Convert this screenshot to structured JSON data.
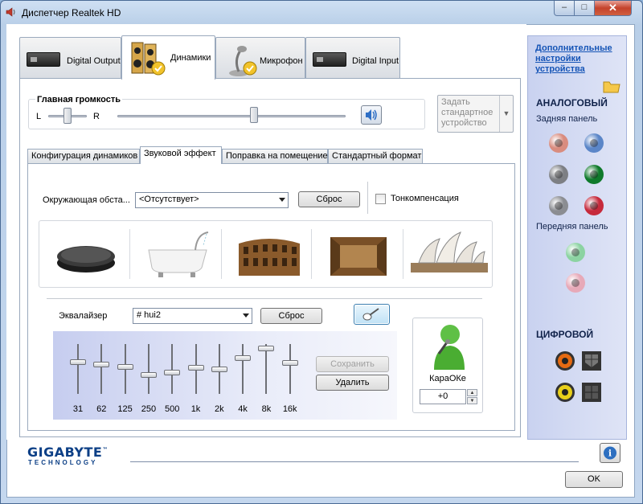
{
  "window": {
    "title": "Диспетчер Realtek HD",
    "min": "–",
    "max": "□",
    "close": "✕"
  },
  "devices": [
    {
      "label": "Digital Output"
    },
    {
      "label": "Динамики"
    },
    {
      "label": "Микрофон"
    },
    {
      "label": "Digital Input"
    }
  ],
  "volume": {
    "title": "Главная громкость",
    "left": "L",
    "right": "R",
    "balance": 0.5,
    "level": 0.6
  },
  "default_device": {
    "label": "Задать стандартное устройство"
  },
  "subtabs": [
    "Конфигурация динамиков",
    "Звуковой эффект",
    "Поправка на помещение",
    "Стандартный формат"
  ],
  "environment": {
    "label": "Окружающая обста...",
    "value": "<Отсутствует>",
    "reset": "Сброс",
    "loudness_label": "Тонкомпенсация",
    "loudness_checked": false
  },
  "equalizer": {
    "label": "Эквалайзер",
    "value": "# hui2",
    "reset": "Сброс",
    "save": "Сохранить",
    "delete": "Удалить",
    "bands": [
      {
        "freq": "31",
        "level": 0.35
      },
      {
        "freq": "62",
        "level": 0.4
      },
      {
        "freq": "125",
        "level": 0.45
      },
      {
        "freq": "250",
        "level": 0.62
      },
      {
        "freq": "500",
        "level": 0.57
      },
      {
        "freq": "1k",
        "level": 0.47
      },
      {
        "freq": "2k",
        "level": 0.5
      },
      {
        "freq": "4k",
        "level": 0.28
      },
      {
        "freq": "8k",
        "level": 0.08
      },
      {
        "freq": "16k",
        "level": 0.37
      }
    ]
  },
  "karaoke": {
    "label": "КараОКе",
    "value": "+0"
  },
  "right_panel": {
    "link": "Дополнительные настройки устройства",
    "analog": "АНАЛОГОВЫЙ",
    "rear": "Задняя панель",
    "front": "Передняя панель",
    "digital": "ЦИФРОВОЙ",
    "rear_jacks": [
      "#d98c7f",
      "#5b86c8",
      "#7d7f84",
      "#0f7a2b",
      "#8b8d92",
      "#c62a3c"
    ],
    "front_jacks": [
      "#8cd3a2",
      "#e7a9b8"
    ]
  },
  "footer": {
    "brand": "GIGABYTE",
    "tm": "™",
    "sub": "TECHNOLOGY",
    "ok": "OK",
    "info_icon": "i"
  }
}
